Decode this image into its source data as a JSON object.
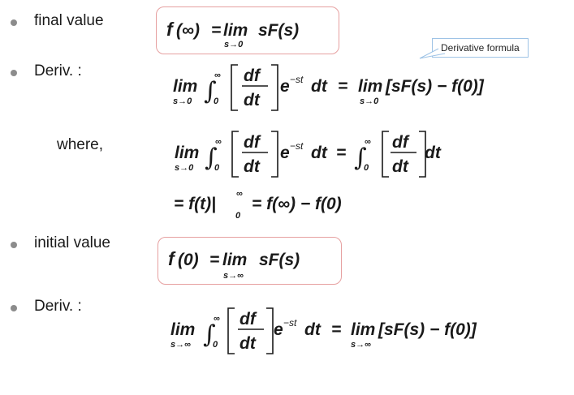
{
  "bullets": {
    "final_value": "final value",
    "deriv_1": "Deriv. :",
    "where": "where,",
    "initial_value": "initial value",
    "deriv_2": "Deriv. :"
  },
  "callout": "Derivative formula",
  "math": {
    "f": "f",
    "lim": "lim",
    "sF_s": "sF(s)",
    "eq": "=",
    "paren_inf": "(∞)",
    "paren_0": "(0)",
    "sub_s0": "s→0",
    "sub_sinf": "s→∞",
    "integral": "∫",
    "inf": "∞",
    "zero": "0",
    "df": "df",
    "dt": "dt",
    "e": "e",
    "exp": "−st",
    "rhs_bracket": "[sF(s) − f(0)]",
    "line3": "= f(t)|",
    "line3_rhs": "= f(∞) − f(0)"
  },
  "colors": {
    "box_border": "#e6a0a0",
    "callout_border": "#9ec3e6",
    "bullet": "#8c8c8c"
  }
}
